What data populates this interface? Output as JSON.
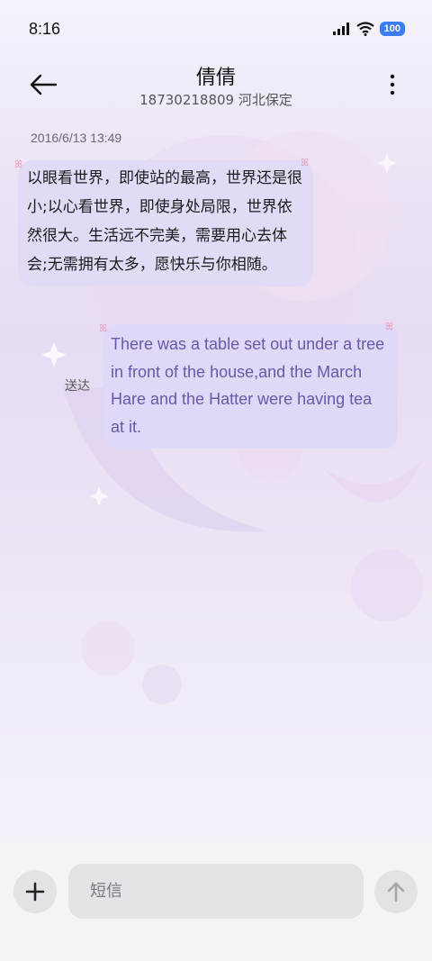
{
  "status_bar": {
    "time": "8:16",
    "battery": "100",
    "icons": [
      "signal-icon",
      "wifi-icon",
      "battery-icon"
    ]
  },
  "header": {
    "contact_name": "倩倩",
    "contact_sub": "18730218809 河北保定",
    "back_icon": "back-arrow-icon",
    "more_icon": "more-vertical-icon"
  },
  "conversation": {
    "timestamp": "2016/6/13 13:49",
    "messages": [
      {
        "direction": "incoming",
        "text": "以眼看世界，即使站的最高，世界还是很小;以心看世界，即使身处局限，世界依然很大。生活远不完美，需要用心去体会;无需拥有太多，愿快乐与你相随。"
      },
      {
        "direction": "outgoing",
        "text": "There was a table set out under a tree in front of the house,and the March Hare and the Hatter were having tea at it.",
        "status": "送达"
      }
    ]
  },
  "composer": {
    "placeholder": "短信",
    "add_icon": "plus-icon",
    "send_icon": "send-arrow-icon"
  },
  "colors": {
    "accent_battery": "#3a7bf6",
    "outgoing_text": "#6a57a8",
    "bubble_bg": "#e0daf6"
  }
}
